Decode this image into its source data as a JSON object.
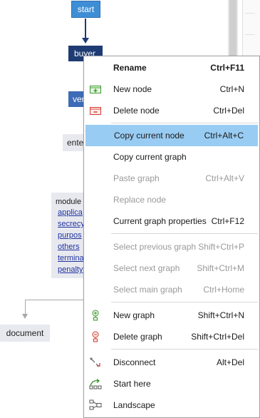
{
  "graph": {
    "nodes": {
      "start": "start",
      "buyer": "buyer",
      "vendor": "ver",
      "enter": "ente",
      "document": "document"
    },
    "module": {
      "title": "module",
      "links": [
        "applica",
        "secrecy",
        "purpos",
        "others",
        "termina",
        "penalty"
      ]
    }
  },
  "context_menu": {
    "items": [
      {
        "label": "Rename",
        "shortcut": "Ctrl+F11",
        "icon": "",
        "disabled": false,
        "bold": true
      },
      {
        "label": "New node",
        "shortcut": "Ctrl+N",
        "icon": "new-node-icon",
        "disabled": false
      },
      {
        "label": "Delete node",
        "shortcut": "Ctrl+Del",
        "icon": "delete-node-icon",
        "disabled": false
      },
      {
        "label": "Copy current node",
        "shortcut": "Ctrl+Alt+C",
        "icon": "",
        "disabled": false,
        "highlighted": true
      },
      {
        "label": "Copy current graph",
        "shortcut": "",
        "icon": "",
        "disabled": false
      },
      {
        "label": "Paste graph",
        "shortcut": "Ctrl+Alt+V",
        "icon": "",
        "disabled": true
      },
      {
        "label": "Replace node",
        "shortcut": "",
        "icon": "",
        "disabled": true
      },
      {
        "label": "Current graph properties",
        "shortcut": "Ctrl+F12",
        "icon": "",
        "disabled": false
      },
      {
        "label": "Select previous graph",
        "shortcut": "Shift+Ctrl+P",
        "icon": "",
        "disabled": true
      },
      {
        "label": "Select next graph",
        "shortcut": "Shift+Ctrl+M",
        "icon": "",
        "disabled": true
      },
      {
        "label": "Select main graph",
        "shortcut": "Ctrl+Home",
        "icon": "",
        "disabled": true
      },
      {
        "label": "New graph",
        "shortcut": "Shift+Ctrl+N",
        "icon": "new-graph-icon",
        "disabled": false
      },
      {
        "label": "Delete graph",
        "shortcut": "Shift+Ctrl+Del",
        "icon": "delete-graph-icon",
        "disabled": false
      },
      {
        "label": "Disconnect",
        "shortcut": "Alt+Del",
        "icon": "disconnect-icon",
        "disabled": false
      },
      {
        "label": "Start here",
        "shortcut": "",
        "icon": "start-here-icon",
        "disabled": false
      },
      {
        "label": "Landscape",
        "shortcut": "",
        "icon": "landscape-icon",
        "disabled": false
      }
    ]
  },
  "colors": {
    "highlight": "#99ccf3",
    "node_start": "#3e8ed6",
    "node_buyer": "#1e3b73",
    "node_light": "#e8e9ef",
    "link": "#2033a0",
    "disabled_text": "#9a9a9a"
  }
}
